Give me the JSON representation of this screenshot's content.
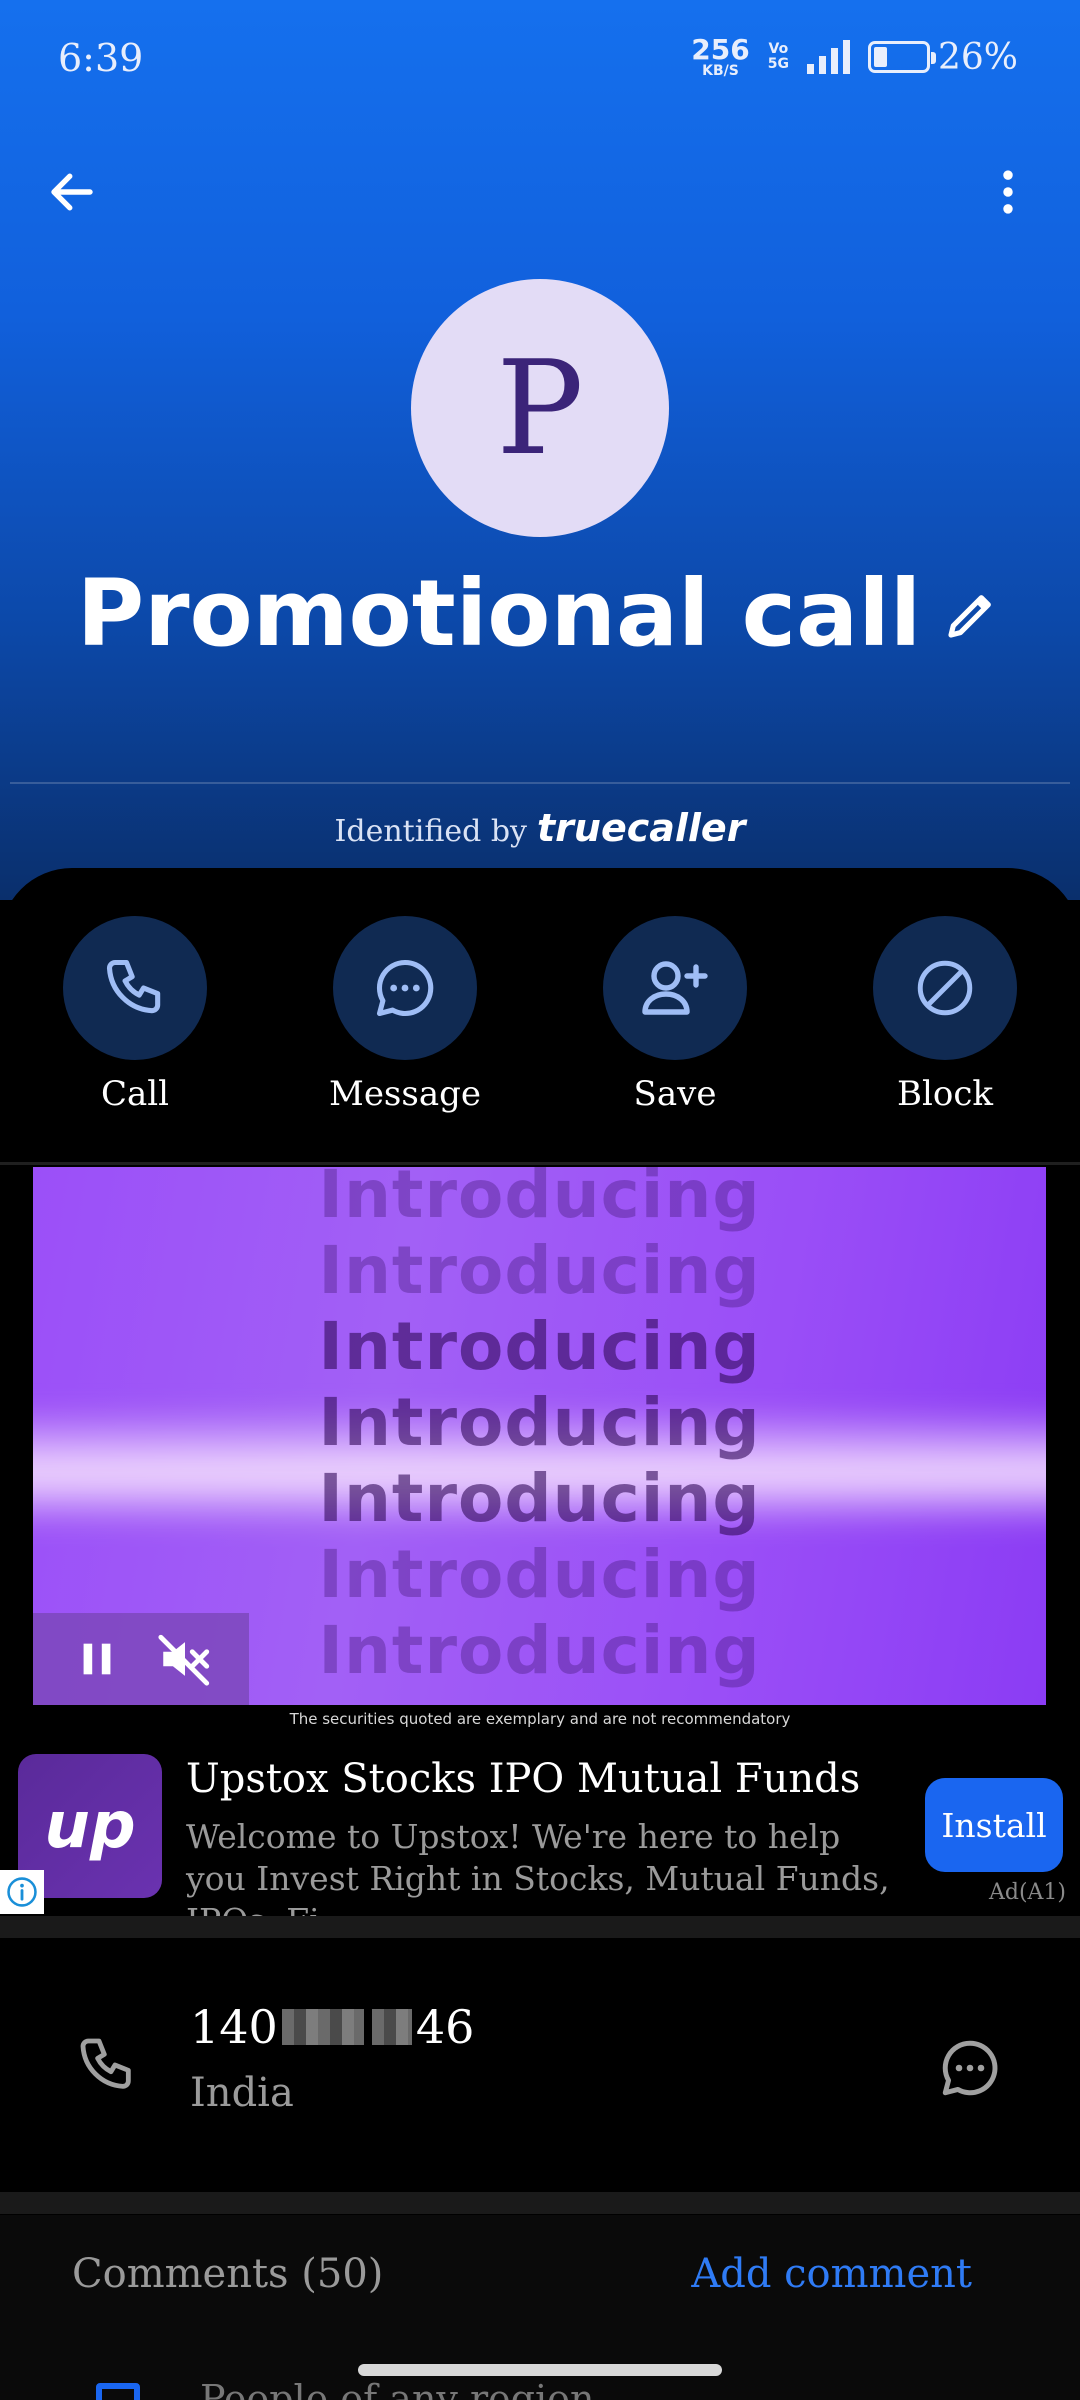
{
  "status_bar": {
    "time": "6:39",
    "net_speed_value": "256",
    "net_speed_unit": "KB/S",
    "volte_line1": "Vo",
    "volte_line2": "5G",
    "battery_percent": "26%",
    "battery_level": 0.26
  },
  "header": {
    "back_icon": "arrow-left-icon",
    "more_icon": "more-vertical-icon",
    "avatar_letter": "P",
    "contact_name": "Promotional call",
    "identified_by": "Identified by",
    "brand": "truecaller"
  },
  "actions": [
    {
      "label": "Call",
      "icon": "phone-icon"
    },
    {
      "label": "Message",
      "icon": "chat-bubble-icon"
    },
    {
      "label": "Save",
      "icon": "add-person-icon"
    },
    {
      "label": "Block",
      "icon": "block-icon"
    }
  ],
  "ad": {
    "video_word": "Introducing",
    "disclaimer": "The securities quoted are exemplary and are not recommendatory",
    "app_icon_text": "up",
    "title": "Upstox Stocks IPO Mutual Funds",
    "description": "Welcome to Upstox! We're here to help you Invest Right in Stocks, Mutual Funds, IPOs, Fi…",
    "install_label": "Install",
    "ad_tag": "Ad(A1)"
  },
  "phone": {
    "number_start": "140",
    "number_end": "46",
    "country": "India"
  },
  "comments": {
    "title": "Comments (50)",
    "add_label": "Add comment",
    "peek_text": "People of any region"
  },
  "colors": {
    "accent": "#1a66f0",
    "action_circle": "#102a52",
    "avatar_bg": "#e3dcf6",
    "avatar_text": "#3b2479"
  }
}
